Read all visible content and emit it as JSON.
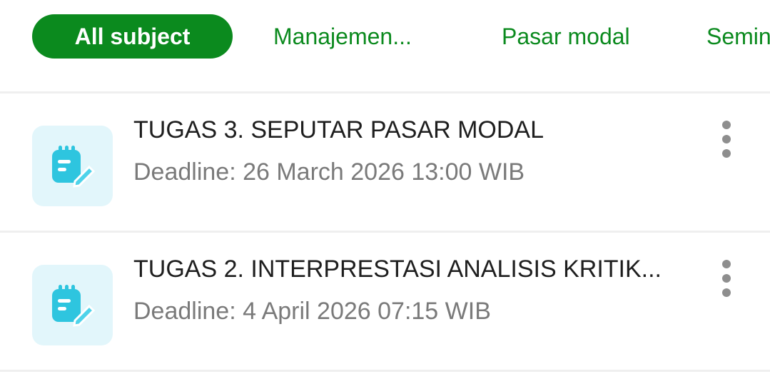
{
  "tabs": [
    {
      "label": "All subject",
      "active": true
    },
    {
      "label": "Manajemen...",
      "active": false
    },
    {
      "label": "Pasar modal",
      "active": false
    },
    {
      "label": "Semin",
      "active": false
    }
  ],
  "assignments": [
    {
      "title": "TUGAS 3.  SEPUTAR PASAR MODAL",
      "deadline": "Deadline: 26 March 2026 13:00 WIB",
      "icon": "notepad-edit-icon"
    },
    {
      "title": "TUGAS 2. INTERPRESTASI ANALISIS KRITIK...",
      "deadline": "Deadline: 4 April 2026 07:15 WIB",
      "icon": "notepad-edit-icon"
    }
  ],
  "colors": {
    "accent": "#0b8a1e",
    "icon_bg": "#e2f6fb",
    "icon_fg": "#2ec5df",
    "title": "#1e1e1e",
    "deadline": "#7a7a7a"
  }
}
